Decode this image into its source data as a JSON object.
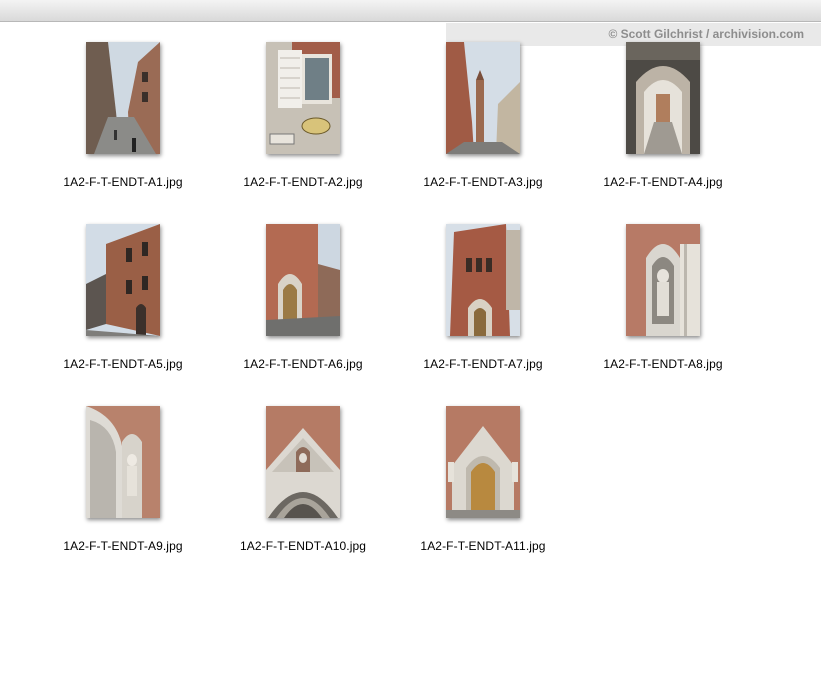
{
  "watermark": "© Scott Gilchrist / archivision.com",
  "files": [
    {
      "name": "1A2-F-T-ENDT-A1.jpg",
      "scene": "street"
    },
    {
      "name": "1A2-F-T-ENDT-A2.jpg",
      "scene": "window-sign"
    },
    {
      "name": "1A2-F-T-ENDT-A3.jpg",
      "scene": "street-tower"
    },
    {
      "name": "1A2-F-T-ENDT-A4.jpg",
      "scene": "archway"
    },
    {
      "name": "1A2-F-T-ENDT-A5.jpg",
      "scene": "brick-facade"
    },
    {
      "name": "1A2-F-T-ENDT-A6.jpg",
      "scene": "church-street"
    },
    {
      "name": "1A2-F-T-ENDT-A7.jpg",
      "scene": "church-tower"
    },
    {
      "name": "1A2-F-T-ENDT-A8.jpg",
      "scene": "niche-statue"
    },
    {
      "name": "1A2-F-T-ENDT-A9.jpg",
      "scene": "portal-statue"
    },
    {
      "name": "1A2-F-T-ENDT-A10.jpg",
      "scene": "gable-statue"
    },
    {
      "name": "1A2-F-T-ENDT-A11.jpg",
      "scene": "church-door"
    }
  ]
}
